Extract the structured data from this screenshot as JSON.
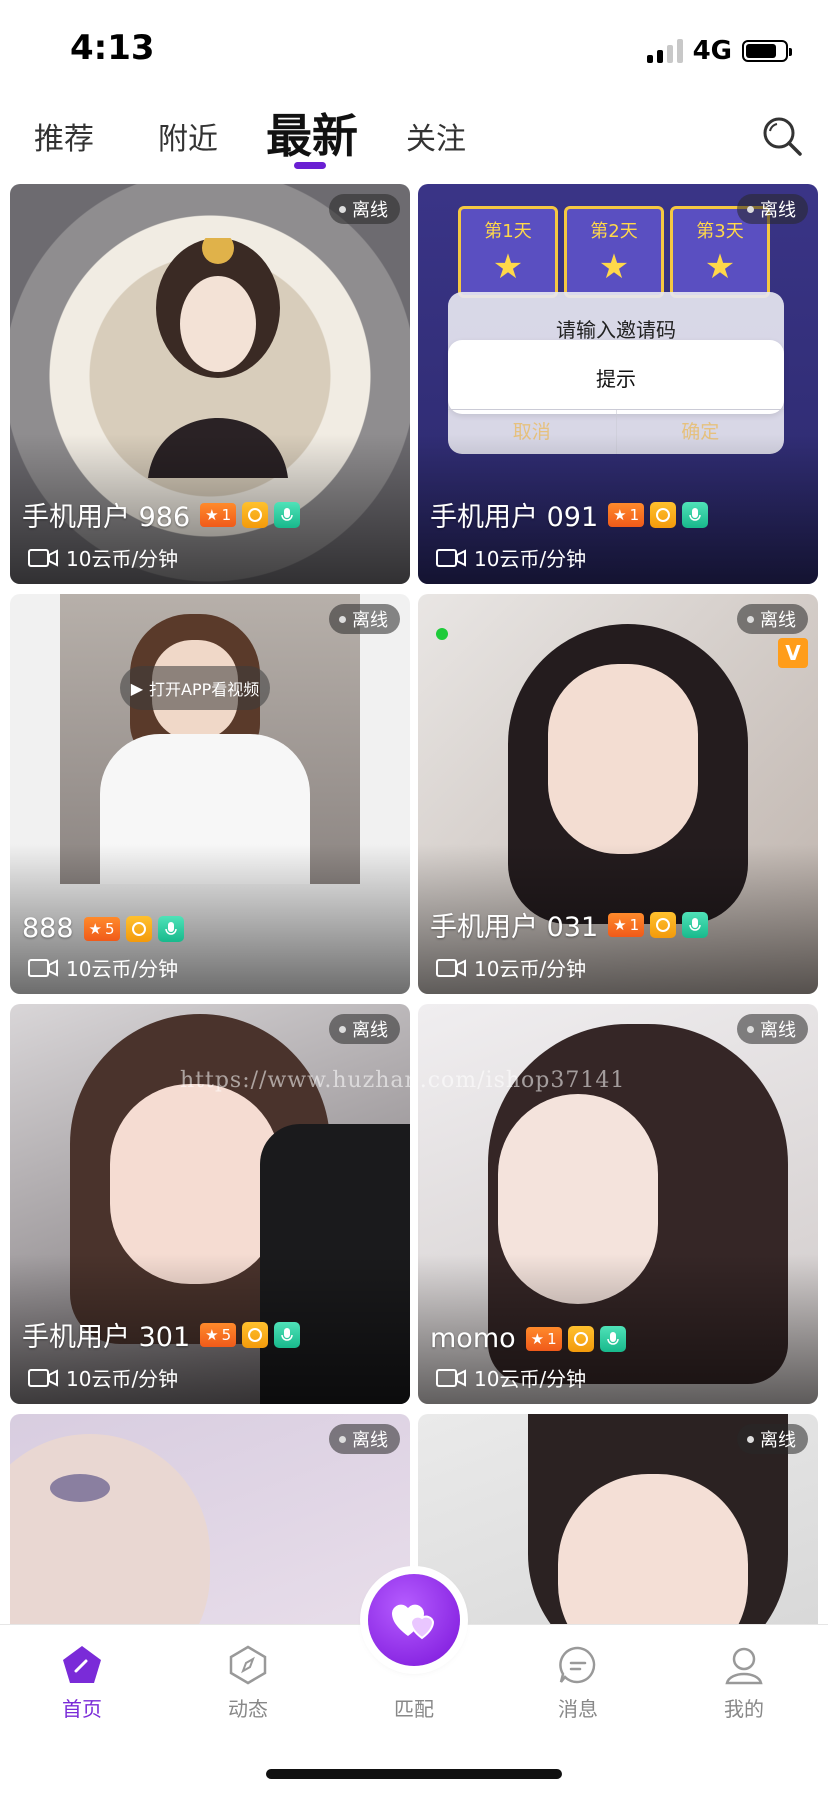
{
  "status_bar": {
    "time": "4:13",
    "network": "4G"
  },
  "tabs": [
    {
      "label": "推荐"
    },
    {
      "label": "附近"
    },
    {
      "label": "最新",
      "active": true
    },
    {
      "label": "关注"
    }
  ],
  "cards": [
    {
      "name": "手机用户 986",
      "level": "1",
      "price": "10云币/分钟",
      "status": "离线"
    },
    {
      "name": "手机用户 091",
      "level": "1",
      "price": "10云币/分钟",
      "status": "离线",
      "overlay_dialog": {
        "title": "请输入邀请码",
        "prompt": "提示",
        "cancel": "取消",
        "confirm": "确定",
        "days": [
          "第1天",
          "第2天",
          "第3天"
        ]
      }
    },
    {
      "name": "888",
      "level": "5",
      "price": "10云币/分钟",
      "status": "离线",
      "video_button": "打开APP看视频"
    },
    {
      "name": "手机用户 031",
      "level": "1",
      "price": "10云币/分钟",
      "status": "离线",
      "vip_mark": "V"
    },
    {
      "name": "手机用户 301",
      "level": "5",
      "price": "10云币/分钟",
      "status": "离线"
    },
    {
      "name": "momo",
      "level": "1",
      "price": "10云币/分钟",
      "status": "离线"
    },
    {
      "status": "离线"
    },
    {
      "status": "离线"
    }
  ],
  "watermark": "https://www.huzhan.com/ishop37141",
  "bottom_nav": [
    {
      "label": "首页",
      "icon": "home-icon",
      "active": true
    },
    {
      "label": "动态",
      "icon": "compass-icon"
    },
    {
      "label": "匹配",
      "icon": "heart-match-icon"
    },
    {
      "label": "消息",
      "icon": "chat-icon"
    },
    {
      "label": "我的",
      "icon": "profile-icon"
    }
  ],
  "colors": {
    "accent": "#7a2bd8",
    "level_badge": "#f05a1a"
  }
}
